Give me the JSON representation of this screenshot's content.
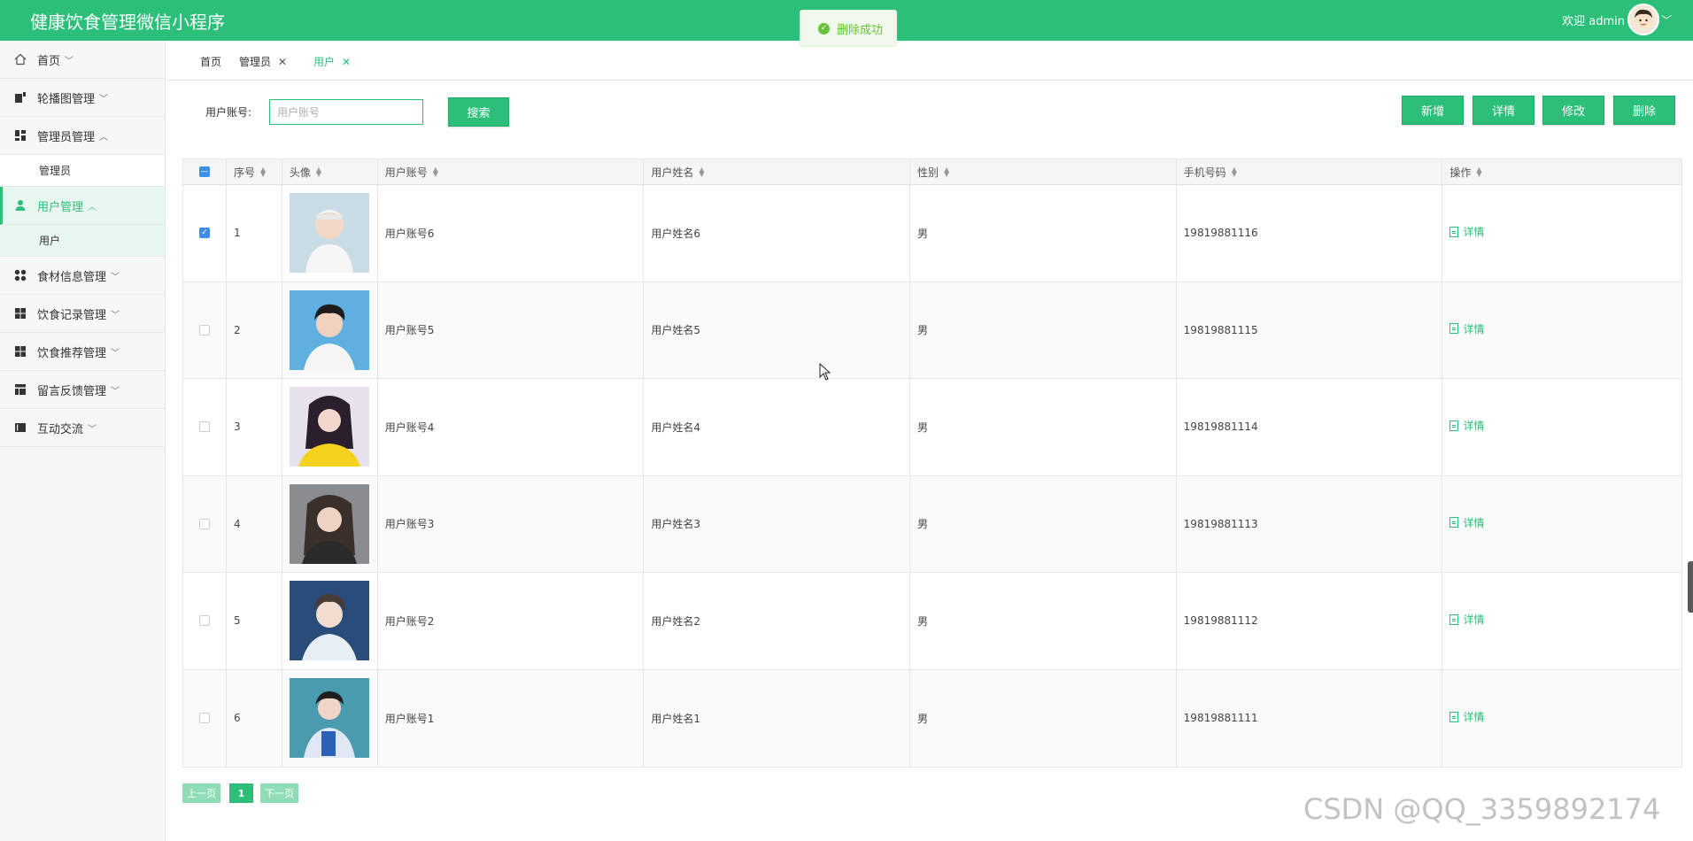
{
  "app": {
    "title": "健康饮食管理微信小程序",
    "welcome": "欢迎 admin"
  },
  "toast": {
    "message": "删除成功"
  },
  "sidebar": {
    "items": [
      {
        "label": "首页"
      },
      {
        "label": "轮播图管理"
      },
      {
        "label": "管理员管理"
      },
      {
        "label": "管理员"
      },
      {
        "label": "用户管理"
      },
      {
        "label": "用户"
      },
      {
        "label": "食材信息管理"
      },
      {
        "label": "饮食记录管理"
      },
      {
        "label": "饮食推荐管理"
      },
      {
        "label": "留言反馈管理"
      },
      {
        "label": "互动交流"
      }
    ]
  },
  "tabs": [
    {
      "label": "首页"
    },
    {
      "label": "管理员"
    },
    {
      "label": "用户"
    }
  ],
  "search": {
    "label": "用户账号:",
    "placeholder": "用户账号",
    "button": "搜索"
  },
  "actions": {
    "add": "新增",
    "detail": "详情",
    "edit": "修改",
    "delete": "删除"
  },
  "table": {
    "columns": [
      "序号",
      "头像",
      "用户账号",
      "用户姓名",
      "性别",
      "手机号码",
      "操作"
    ],
    "detail_label": "详情",
    "rows": [
      {
        "no": "1",
        "account": "用户账号6",
        "name": "用户姓名6",
        "gender": "男",
        "phone": "19819881116",
        "checked": true
      },
      {
        "no": "2",
        "account": "用户账号5",
        "name": "用户姓名5",
        "gender": "男",
        "phone": "19819881115",
        "checked": false
      },
      {
        "no": "3",
        "account": "用户账号4",
        "name": "用户姓名4",
        "gender": "男",
        "phone": "19819881114",
        "checked": false
      },
      {
        "no": "4",
        "account": "用户账号3",
        "name": "用户姓名3",
        "gender": "男",
        "phone": "19819881113",
        "checked": false
      },
      {
        "no": "5",
        "account": "用户账号2",
        "name": "用户姓名2",
        "gender": "男",
        "phone": "19819881112",
        "checked": false
      },
      {
        "no": "6",
        "account": "用户账号1",
        "name": "用户姓名1",
        "gender": "男",
        "phone": "19819881111",
        "checked": false
      }
    ]
  },
  "pagination": {
    "prev": "上一页",
    "current": "1",
    "next": "下一页"
  },
  "watermark": "CSDN @QQ_3359892174",
  "colors": {
    "primary": "#2bbf7a",
    "active_bg": "#e8f7ef",
    "checkbox": "#3a8ee6",
    "toast_text": "#67c23a"
  }
}
